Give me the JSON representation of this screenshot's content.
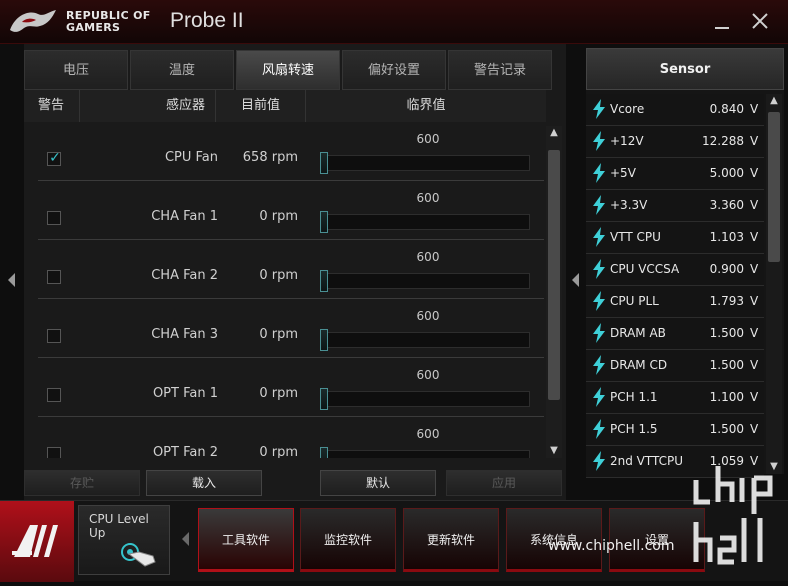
{
  "titlebar": {
    "brand_line1": "REPUBLIC OF",
    "brand_line2": "GAMERS",
    "app_title": "Probe II",
    "minimize_icon": "minimize-icon",
    "close_icon": "close-icon"
  },
  "tabs": [
    {
      "label": "电压",
      "active": false
    },
    {
      "label": "温度",
      "active": false
    },
    {
      "label": "风扇转速",
      "active": true
    },
    {
      "label": "偏好设置",
      "active": false
    },
    {
      "label": "警告记录",
      "active": false
    }
  ],
  "columns": {
    "alert": "警告",
    "sensor": "感应器",
    "current": "目前值",
    "threshold": "临界值"
  },
  "fan_rows": [
    {
      "checked": true,
      "name": "CPU Fan",
      "value": "658 rpm",
      "threshold": "600"
    },
    {
      "checked": false,
      "name": "CHA Fan 1",
      "value": "0 rpm",
      "threshold": "600"
    },
    {
      "checked": false,
      "name": "CHA Fan 2",
      "value": "0 rpm",
      "threshold": "600"
    },
    {
      "checked": false,
      "name": "CHA Fan 3",
      "value": "0 rpm",
      "threshold": "600"
    },
    {
      "checked": false,
      "name": "OPT Fan 1",
      "value": "0 rpm",
      "threshold": "600"
    },
    {
      "checked": false,
      "name": "OPT Fan 2",
      "value": "0 rpm",
      "threshold": "600"
    }
  ],
  "actions": {
    "save": "存贮",
    "load": "载入",
    "default": "默认",
    "apply": "应用"
  },
  "sensor_panel": {
    "title": "Sensor",
    "items": [
      {
        "name": "Vcore",
        "value": "0.840",
        "unit": "V"
      },
      {
        "name": "+12V",
        "value": "12.288",
        "unit": "V"
      },
      {
        "name": "+5V",
        "value": "5.000",
        "unit": "V"
      },
      {
        "name": "+3.3V",
        "value": "3.360",
        "unit": "V"
      },
      {
        "name": "VTT CPU",
        "value": "1.103",
        "unit": "V"
      },
      {
        "name": "CPU VCCSA",
        "value": "0.900",
        "unit": "V"
      },
      {
        "name": "CPU PLL",
        "value": "1.793",
        "unit": "V"
      },
      {
        "name": "DRAM AB",
        "value": "1.500",
        "unit": "V"
      },
      {
        "name": "DRAM CD",
        "value": "1.500",
        "unit": "V"
      },
      {
        "name": "PCH 1.1",
        "value": "1.100",
        "unit": "V"
      },
      {
        "name": "PCH 1.5",
        "value": "1.500",
        "unit": "V"
      },
      {
        "name": "2nd VTTCPU",
        "value": "1.059",
        "unit": "V"
      }
    ]
  },
  "bottom": {
    "cpu_level_line1": "CPU Level",
    "cpu_level_line2": "Up",
    "nav": [
      "工具软件",
      "监控软件",
      "更新软件",
      "系统信息",
      "设置"
    ],
    "watermark": "www.chiphell.com"
  },
  "colors": {
    "accent_red": "#b01018",
    "check_cyan": "#38c0c8"
  }
}
